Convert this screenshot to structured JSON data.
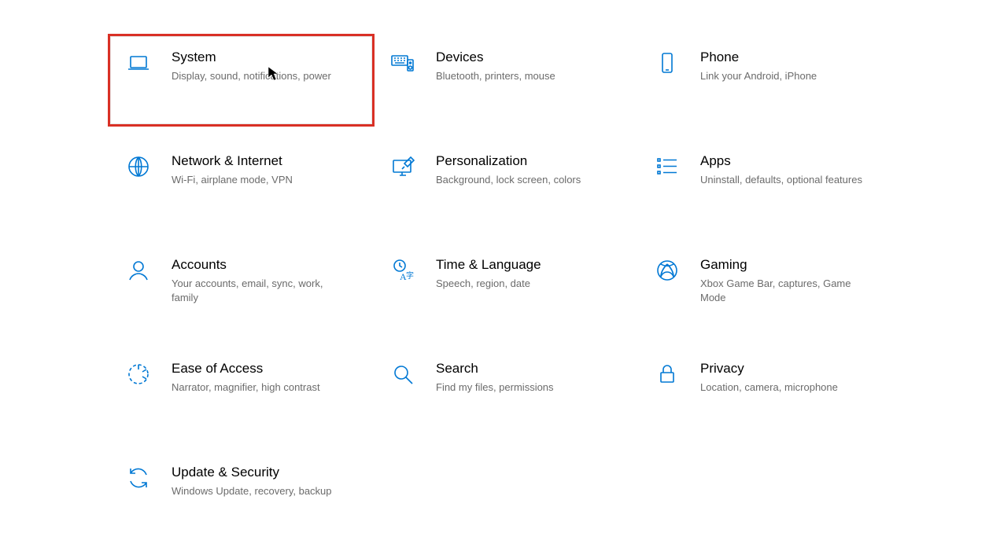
{
  "categories": [
    {
      "id": "system",
      "title": "System",
      "desc": "Display, sound, notifications, power",
      "icon": "laptop",
      "highlight": true
    },
    {
      "id": "devices",
      "title": "Devices",
      "desc": "Bluetooth, printers, mouse",
      "icon": "devices",
      "highlight": false
    },
    {
      "id": "phone",
      "title": "Phone",
      "desc": "Link your Android, iPhone",
      "icon": "phone",
      "highlight": false
    },
    {
      "id": "network",
      "title": "Network & Internet",
      "desc": "Wi-Fi, airplane mode, VPN",
      "icon": "globe",
      "highlight": false
    },
    {
      "id": "personalization",
      "title": "Personalization",
      "desc": "Background, lock screen, colors",
      "icon": "personalize",
      "highlight": false
    },
    {
      "id": "apps",
      "title": "Apps",
      "desc": "Uninstall, defaults, optional features",
      "icon": "apps",
      "highlight": false
    },
    {
      "id": "accounts",
      "title": "Accounts",
      "desc": "Your accounts, email, sync, work, family",
      "icon": "person",
      "highlight": false
    },
    {
      "id": "time-language",
      "title": "Time & Language",
      "desc": "Speech, region, date",
      "icon": "time-language",
      "highlight": false
    },
    {
      "id": "gaming",
      "title": "Gaming",
      "desc": "Xbox Game Bar, captures, Game Mode",
      "icon": "gaming",
      "highlight": false
    },
    {
      "id": "ease-of-access",
      "title": "Ease of Access",
      "desc": "Narrator, magnifier, high contrast",
      "icon": "ease",
      "highlight": false
    },
    {
      "id": "search",
      "title": "Search",
      "desc": "Find my files, permissions",
      "icon": "search",
      "highlight": false
    },
    {
      "id": "privacy",
      "title": "Privacy",
      "desc": "Location, camera, microphone",
      "icon": "lock",
      "highlight": false
    },
    {
      "id": "update-security",
      "title": "Update & Security",
      "desc": "Windows Update, recovery, backup",
      "icon": "update",
      "highlight": false
    }
  ]
}
